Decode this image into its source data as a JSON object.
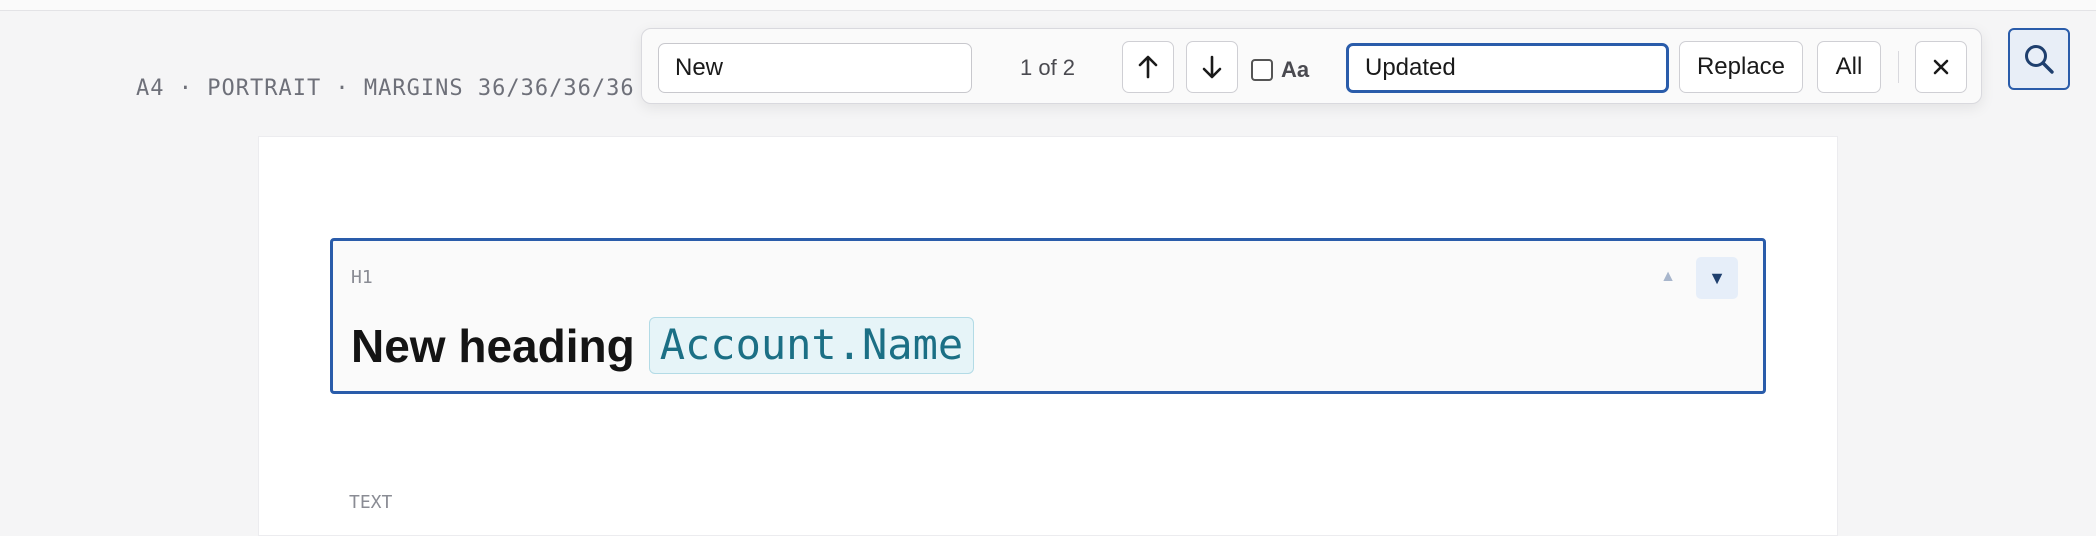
{
  "document": {
    "page_meta": "A4 · PORTRAIT · MARGINS 36/36/36/36"
  },
  "find_replace": {
    "find_value": "New",
    "match_count": "1 of 2",
    "prev_icon": "arrow-up-icon",
    "next_icon": "arrow-down-icon",
    "match_case_label": "Aa",
    "match_case_checked": false,
    "replace_value": "Updated",
    "replace_label": "Replace",
    "replace_all_label": "All",
    "close_icon": "close-icon"
  },
  "toolbar": {
    "search_icon": "search-icon"
  },
  "blocks": [
    {
      "tag": "H1",
      "text": "New heading",
      "token": "Account.Name",
      "move_up_glyph": "▲",
      "move_down_glyph": "▼"
    },
    {
      "tag": "TEXT"
    }
  ],
  "colors": {
    "accent": "#2a5caa",
    "token_text": "#1b6f85",
    "token_bg": "#e6f4f8"
  }
}
